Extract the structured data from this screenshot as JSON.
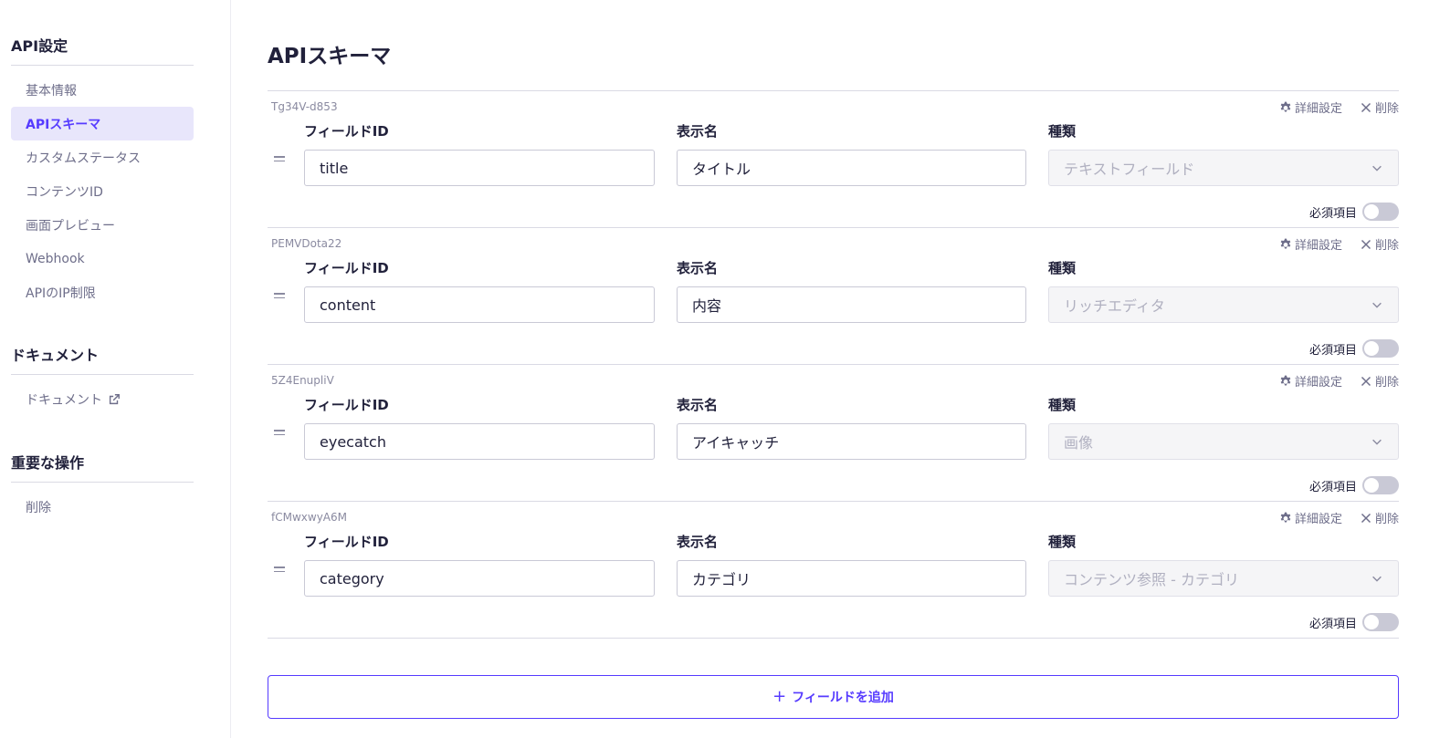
{
  "sidebar": {
    "sections": [
      {
        "heading": "API設定",
        "items": [
          {
            "label": "基本情報",
            "active": false
          },
          {
            "label": "APIスキーマ",
            "active": true
          },
          {
            "label": "カスタムステータス",
            "active": false
          },
          {
            "label": "コンテンツID",
            "active": false
          },
          {
            "label": "画面プレビュー",
            "active": false
          },
          {
            "label": "Webhook",
            "active": false
          },
          {
            "label": "APIのIP制限",
            "active": false
          }
        ]
      },
      {
        "heading": "ドキュメント",
        "items": [
          {
            "label": "ドキュメント",
            "icon": "external-link-icon"
          }
        ]
      },
      {
        "heading": "重要な操作",
        "items": [
          {
            "label": "削除"
          }
        ]
      }
    ]
  },
  "main": {
    "title": "APIスキーマ",
    "labels": {
      "field_id": "フィールドID",
      "display_name": "表示名",
      "type": "種類",
      "detail_settings": "詳細設定",
      "delete": "削除",
      "required": "必須項目"
    },
    "fields": [
      {
        "key": "Tg34V-d853",
        "field_id": "title",
        "display_name": "タイトル",
        "type": "テキストフィールド",
        "required": false
      },
      {
        "key": "PEMVDota22",
        "field_id": "content",
        "display_name": "内容",
        "type": "リッチエディタ",
        "required": false
      },
      {
        "key": "5Z4EnupliV",
        "field_id": "eyecatch",
        "display_name": "アイキャッチ",
        "type": "画像",
        "required": false
      },
      {
        "key": "fCMwxwyA6M",
        "field_id": "category",
        "display_name": "カテゴリ",
        "type": "コンテンツ参照 - カテゴリ",
        "required": false
      }
    ],
    "add_button": {
      "icon": "+",
      "label": "フィールドを追加"
    }
  },
  "colors": {
    "accent": "#563bff",
    "active_bg": "#e8e6fb",
    "toggle_off": "#c9c9d6"
  }
}
